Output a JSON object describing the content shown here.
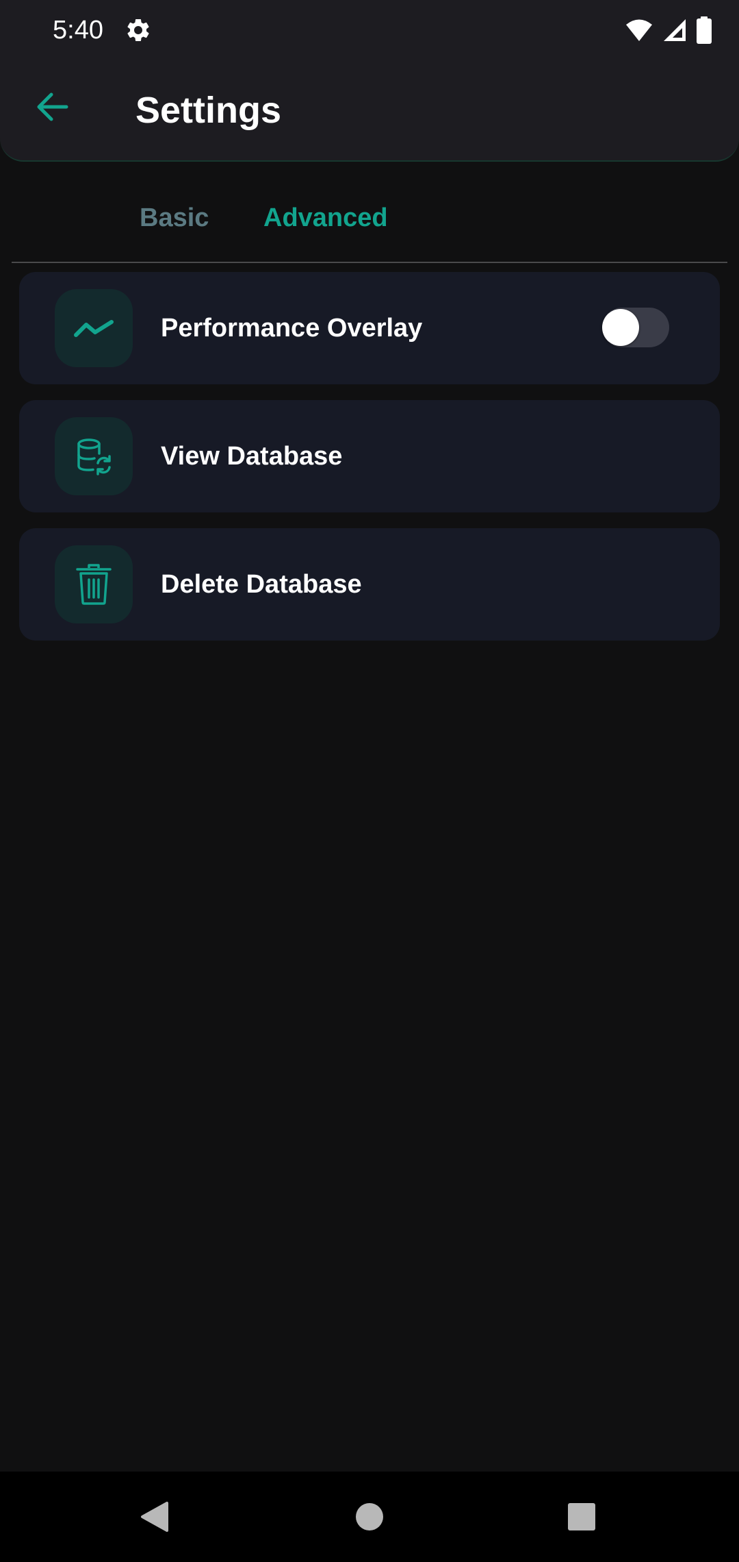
{
  "status_bar": {
    "time": "5:40",
    "icons": [
      "gear-icon",
      "wifi-icon",
      "cellular-signal-icon",
      "battery-icon"
    ]
  },
  "app_bar": {
    "back_icon": "arrow-left-icon",
    "title": "Settings"
  },
  "tabs": [
    {
      "label": "Basic",
      "selected": false
    },
    {
      "label": "Advanced",
      "selected": true
    }
  ],
  "items": [
    {
      "label": "Performance Overlay",
      "icon": "activity-chart-icon",
      "toggle": {
        "on": false
      }
    },
    {
      "label": "View Database",
      "icon": "database-sync-icon"
    },
    {
      "label": "Delete Database",
      "icon": "trash-icon"
    }
  ],
  "nav_bar": {
    "icons": [
      "nav-back-icon",
      "nav-home-icon",
      "nav-recents-icon"
    ]
  },
  "colors": {
    "accent": "#12a48e",
    "background": "#101011",
    "app_bar": "#1d1c21",
    "card": "#171a26",
    "tab_inactive": "#5b7a82"
  }
}
